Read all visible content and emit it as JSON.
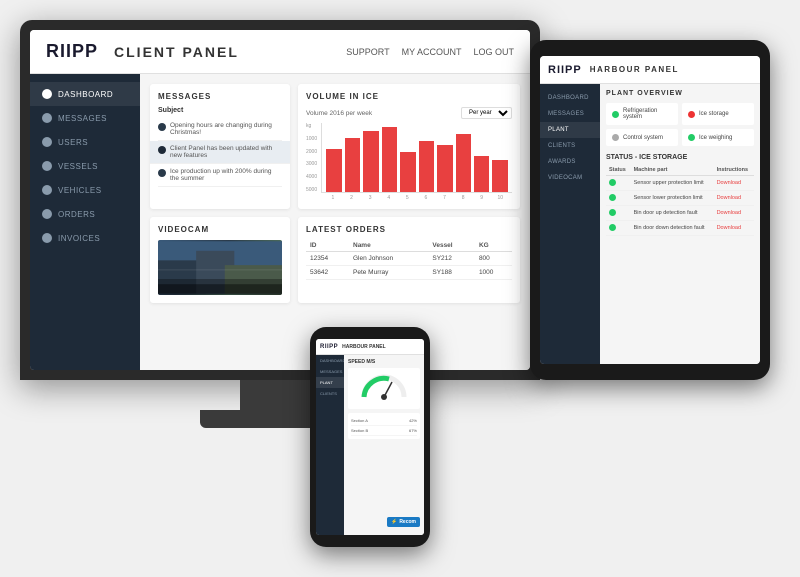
{
  "app": {
    "logo": "RIIPP",
    "client_panel_title": "CLIENT PANEL",
    "harbour_panel_title": "HARBOUR PANEL",
    "nav": {
      "support": "SUPPORT",
      "my_account": "MY ACCOUNT",
      "log_out": "LOG OUT"
    }
  },
  "sidebar": {
    "items": [
      {
        "label": "DASHBOARD",
        "active": true,
        "icon": "dashboard-icon"
      },
      {
        "label": "MESSAGES",
        "active": false,
        "icon": "messages-icon"
      },
      {
        "label": "USERS",
        "active": false,
        "icon": "users-icon"
      },
      {
        "label": "VESSELS",
        "active": false,
        "icon": "vessels-icon"
      },
      {
        "label": "VEHICLES",
        "active": false,
        "icon": "vehicles-icon"
      },
      {
        "label": "ORDERS",
        "active": false,
        "icon": "orders-icon"
      },
      {
        "label": "INVOICES",
        "active": false,
        "icon": "invoices-icon"
      }
    ]
  },
  "messages": {
    "title": "MESSAGES",
    "subject_label": "Subject",
    "items": [
      {
        "text": "Opening hours are changing during Christmas!",
        "selected": false
      },
      {
        "text": "Client Panel has been updated with new features",
        "selected": true
      },
      {
        "text": "Ice production up with 200% during the summer",
        "selected": false
      }
    ]
  },
  "chart": {
    "title": "VOLUME IN ICE",
    "label": "Volume 2016 per week",
    "select_option": "Per year",
    "y_labels": [
      "5000",
      "4000",
      "3000",
      "2000",
      "1000",
      ""
    ],
    "x_labels": [
      "1",
      "2",
      "3",
      "4",
      "5",
      "6",
      "7",
      "8",
      "9",
      "10"
    ],
    "unit": "kg",
    "bars": [
      60,
      75,
      85,
      90,
      55,
      70,
      65,
      80,
      50,
      45
    ]
  },
  "videocam": {
    "title": "VIDEOCAM"
  },
  "orders": {
    "title": "LATEST ORDERS",
    "columns": [
      "ID",
      "Name",
      "Vessel",
      "KG"
    ],
    "rows": [
      {
        "id": "12354",
        "name": "Glen Johnson",
        "vessel": "SY212",
        "kg": "800"
      },
      {
        "id": "53642",
        "name": "Pete Murray",
        "vessel": "SY188",
        "kg": "1000"
      }
    ]
  },
  "harbour_panel": {
    "logo": "RIIPP",
    "title": "HARBOUR PANEL",
    "sidebar_items": [
      {
        "label": "DASHBOARD",
        "active": false
      },
      {
        "label": "MESSAGES",
        "active": false
      },
      {
        "label": "PLANT",
        "active": true
      },
      {
        "label": "CLIENTS",
        "active": false
      },
      {
        "label": "AWARDS",
        "active": false
      },
      {
        "label": "VIDEOCAM",
        "active": false
      }
    ],
    "plant_overview_title": "PLANT OVERVIEW",
    "plant_items": [
      {
        "label": "Refrigeration system",
        "status": "green"
      },
      {
        "label": "Ice storage",
        "status": "red"
      },
      {
        "label": "Control system",
        "status": "gray"
      },
      {
        "label": "Ice weighing",
        "status": "green"
      }
    ],
    "status_title": "STATUS - ICE STORAGE",
    "status_columns": [
      "Status",
      "Machine part",
      "Instructions"
    ],
    "status_rows": [
      {
        "status": "green",
        "part": "Sensor upper protection limit",
        "instruction": "Download"
      },
      {
        "status": "green",
        "part": "Sensor lower protection limit",
        "instruction": "Download"
      },
      {
        "status": "green",
        "part": "Bin door up detection fault",
        "instruction": "Download"
      },
      {
        "status": "green",
        "part": "Bin door down detection fault",
        "instruction": "Download"
      }
    ]
  },
  "phone_panel": {
    "logo": "RIIPP",
    "title": "HARBOUR PANEL",
    "sidebar_items": [
      {
        "label": "DASHBOARD"
      },
      {
        "label": "MESSAGES"
      },
      {
        "label": "PLANT"
      },
      {
        "label": "CLIENTS"
      }
    ],
    "speed_label": "SPEED M/S",
    "gauge_sections": [
      {
        "label": "Section A",
        "value": "42%"
      },
      {
        "label": "Section B",
        "value": "67%"
      }
    ],
    "recom_label": "Recom"
  }
}
